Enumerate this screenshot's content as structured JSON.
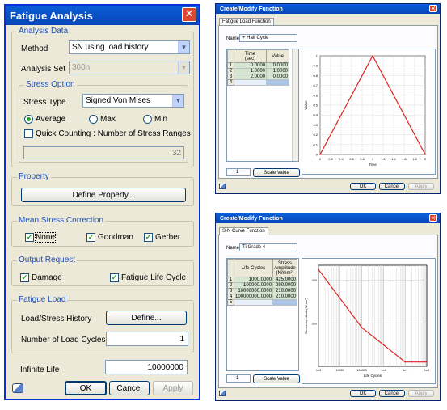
{
  "fatigue": {
    "title": "Fatigue Analysis",
    "analysis_data": {
      "label": "Analysis Data",
      "method_label": "Method",
      "method_value": "SN using load history",
      "set_label": "Analysis Set",
      "set_value": "300n"
    },
    "stress_option": {
      "label": "Stress Option",
      "type_label": "Stress Type",
      "type_value": "Signed Von Mises",
      "average": "Average",
      "max": "Max",
      "min": "Min",
      "selected": "Average",
      "quick_label": "Quick Counting : Number of Stress Ranges",
      "quick_value": "32"
    },
    "property": {
      "label": "Property",
      "button": "Define Property..."
    },
    "mean_stress": {
      "label": "Mean Stress Correction",
      "none": "None",
      "goodman": "Goodman",
      "gerber": "Gerber"
    },
    "output": {
      "label": "Output Request",
      "damage": "Damage",
      "life_cycle": "Fatigue Life Cycle"
    },
    "fatigue_load": {
      "label": "Fatigue Load",
      "history_label": "Load/Stress History",
      "define": "Define...",
      "cycles_label": "Number of Load Cycles",
      "cycles_value": "1"
    },
    "infinite": {
      "label": "Infinite Life",
      "value": "10000000"
    },
    "buttons": {
      "ok": "OK",
      "cancel": "Cancel",
      "apply": "Apply"
    }
  },
  "func1": {
    "title": "Create/Modify Function",
    "tab": "Fatigue Load Function",
    "name_label": "Name",
    "name_value": "+ Half Cycle",
    "headers": [
      "Time\n(sec)",
      "Value"
    ],
    "rows": [
      [
        "0.0000",
        "0.0000"
      ],
      [
        "1.0000",
        "1.0000"
      ],
      [
        "2.0000",
        "0.0000"
      ]
    ],
    "scale_input": "1",
    "scale_button": "Scale Value",
    "buttons": {
      "ok": "OK",
      "cancel": "Cancel",
      "apply": "Apply"
    }
  },
  "func2": {
    "title": "Create/Modify Function",
    "tab": "S-N Curve Function",
    "name_label": "Name",
    "name_value": "Ti Grade 4",
    "headers": [
      "Life Cycles",
      "Stress\nAmplitude\n(N/mm²)"
    ],
    "rows": [
      [
        "1000.0000",
        "425.0000"
      ],
      [
        "100000.0000",
        "290.0000"
      ],
      [
        "10000000.0000",
        "210.0000"
      ],
      [
        "100000000.0000",
        "210.0000"
      ]
    ],
    "scale_input": "1",
    "scale_button": "Scale Value",
    "buttons": {
      "ok": "OK",
      "cancel": "Cancel",
      "apply": "Apply"
    }
  },
  "chart_data": [
    {
      "type": "line",
      "x": [
        0,
        1,
        2
      ],
      "values": [
        0,
        1,
        0
      ],
      "xlabel": "Time",
      "ylabel": "Value",
      "xlim": [
        0,
        2
      ],
      "ylim": [
        0,
        1
      ],
      "xticks": [
        "0",
        "0.2",
        "0.4",
        "0.6",
        "0.8",
        "1",
        "1.2",
        "1.4",
        "1.6",
        "1.8",
        "2"
      ],
      "yticks": [
        "0",
        "0.1",
        "0.2",
        "0.3",
        "0.4",
        "0.5",
        "0.6",
        "0.7",
        "0.8",
        "0.9",
        "1"
      ],
      "color": "#e02020"
    },
    {
      "type": "line",
      "x": [
        1000,
        100000,
        10000000,
        100000000
      ],
      "values": [
        425,
        290,
        210,
        210
      ],
      "xscale": "log",
      "xlabel": "Life Cycles",
      "ylabel": "Stress Amplitude(N/mm²)",
      "xticks": [
        "1e3",
        "10000",
        "100000",
        "1e6",
        "1e7",
        "1e8"
      ],
      "yticks": [
        "400",
        "300"
      ],
      "color": "#e02020"
    }
  ]
}
